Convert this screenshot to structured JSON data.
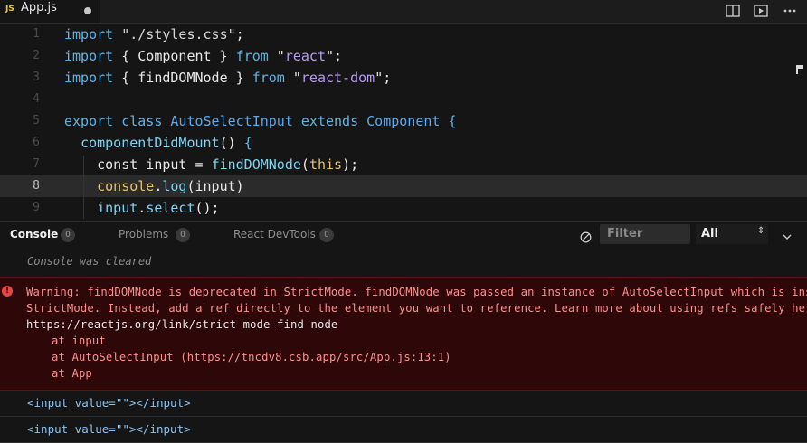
{
  "tab": {
    "icon_label": "JS",
    "filename": "App.js"
  },
  "toolbar": {
    "split_icon": "split-editor-icon",
    "preview_icon": "open-preview-icon",
    "more_icon": "more-actions-icon"
  },
  "editor": {
    "line_numbers": [
      "1",
      "2",
      "3",
      "4",
      "5",
      "6",
      "7",
      "8",
      "9"
    ],
    "lines": [
      {
        "tokens": [
          {
            "c": "kw",
            "t": "import"
          },
          {
            "c": "plain",
            "t": " "
          },
          {
            "c": "str",
            "t": "\"./styles.css\""
          },
          {
            "c": "plain",
            "t": ";"
          }
        ]
      },
      {
        "tokens": [
          {
            "c": "kw",
            "t": "import"
          },
          {
            "c": "plain",
            "t": " { "
          },
          {
            "c": "plain",
            "t": "Component"
          },
          {
            "c": "plain",
            "t": " } "
          },
          {
            "c": "kw",
            "t": "from"
          },
          {
            "c": "plain",
            "t": " \""
          },
          {
            "c": "strc",
            "t": "react"
          },
          {
            "c": "plain",
            "t": "\";"
          }
        ]
      },
      {
        "tokens": [
          {
            "c": "kw",
            "t": "import"
          },
          {
            "c": "plain",
            "t": " { "
          },
          {
            "c": "plain",
            "t": "findDOMNode"
          },
          {
            "c": "plain",
            "t": " } "
          },
          {
            "c": "kw",
            "t": "from"
          },
          {
            "c": "plain",
            "t": " \""
          },
          {
            "c": "strc",
            "t": "react-dom"
          },
          {
            "c": "plain",
            "t": "\";"
          }
        ]
      },
      {
        "tokens": []
      },
      {
        "tokens": [
          {
            "c": "kw",
            "t": "export"
          },
          {
            "c": "plain",
            "t": " "
          },
          {
            "c": "kw",
            "t": "class"
          },
          {
            "c": "plain",
            "t": " "
          },
          {
            "c": "cls",
            "t": "AutoSelectInput"
          },
          {
            "c": "plain",
            "t": " "
          },
          {
            "c": "kw",
            "t": "extends"
          },
          {
            "c": "plain",
            "t": " "
          },
          {
            "c": "cls",
            "t": "Component"
          },
          {
            "c": "plain",
            "t": " "
          },
          {
            "c": "kw",
            "t": "{"
          }
        ]
      },
      {
        "tokens": [
          {
            "c": "plain",
            "t": "  "
          },
          {
            "c": "fn",
            "t": "componentDidMount"
          },
          {
            "c": "plain",
            "t": "() "
          },
          {
            "c": "kw",
            "t": "{"
          }
        ]
      },
      {
        "tokens": [
          {
            "c": "plain",
            "t": "    "
          },
          {
            "c": "plain",
            "t": "const input = "
          },
          {
            "c": "fn",
            "t": "findDOMNode"
          },
          {
            "c": "plain",
            "t": "("
          },
          {
            "c": "yl",
            "t": "this"
          },
          {
            "c": "plain",
            "t": ");"
          }
        ]
      },
      {
        "tokens": [
          {
            "c": "plain",
            "t": "    "
          },
          {
            "c": "yl",
            "t": "console"
          },
          {
            "c": "plain",
            "t": "."
          },
          {
            "c": "fn",
            "t": "log"
          },
          {
            "c": "plain",
            "t": "(input)"
          }
        ]
      },
      {
        "tokens": [
          {
            "c": "plain",
            "t": "    "
          },
          {
            "c": "fn",
            "t": "input"
          },
          {
            "c": "plain",
            "t": "."
          },
          {
            "c": "fn",
            "t": "select"
          },
          {
            "c": "plain",
            "t": "();"
          }
        ]
      }
    ],
    "current_line": "8"
  },
  "panel": {
    "tabs": [
      {
        "label": "Console",
        "count": "0"
      },
      {
        "label": "Problems",
        "count": "0"
      },
      {
        "label": "React DevTools",
        "count": "0"
      }
    ],
    "filter_placeholder": "Filter",
    "level": "All"
  },
  "console": {
    "cleared": "Console was cleared",
    "error_lines": [
      "Warning: findDOMNode is deprecated in StrictMode. findDOMNode was passed an instance of AutoSelectInput which is inside",
      "StrictMode. Instead, add a ref directly to the element you want to reference. Learn more about using refs safely here:",
      "https://reactjs.org/link/strict-mode-find-node"
    ],
    "stack": [
      "at input",
      "at AutoSelectInput (https://tncdv8.csb.app/src/App.js:13:1)",
      "at App"
    ],
    "logs": [
      "<input value=\"\"></input>",
      "<input value=\"\"></input>"
    ]
  }
}
